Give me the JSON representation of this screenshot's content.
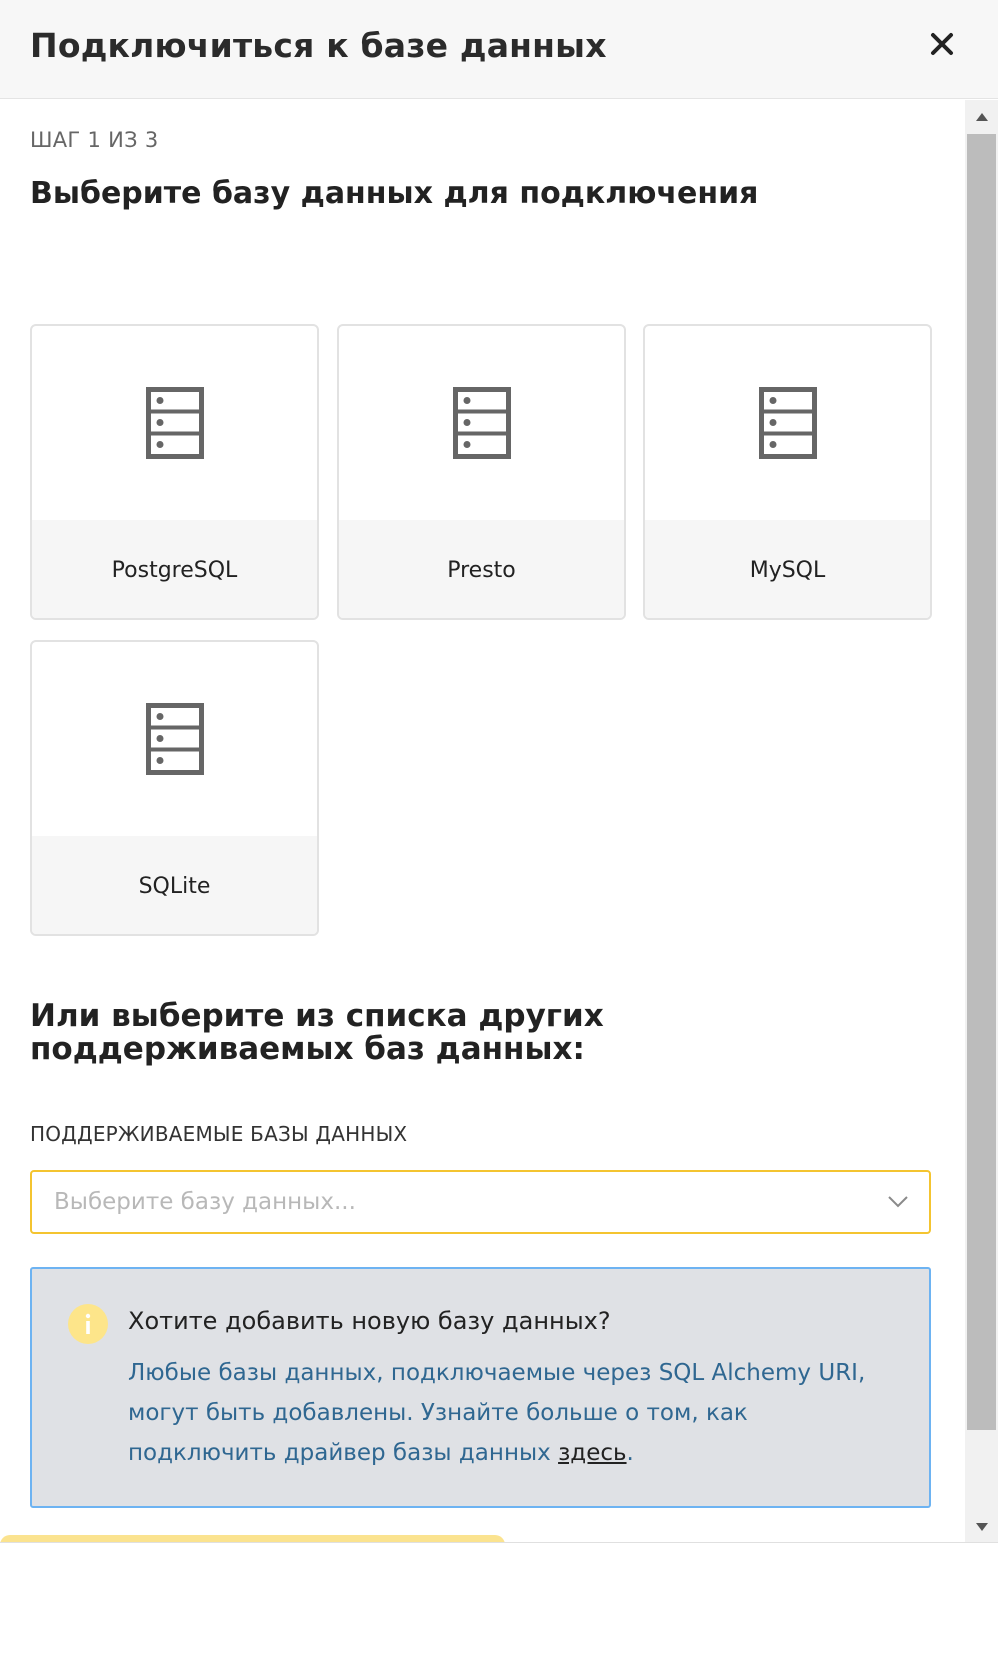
{
  "modal": {
    "title": "Подключиться к базе данных",
    "close_icon": "close-icon"
  },
  "step": {
    "label": "ШАГ 1 ИЗ 3",
    "heading": "Выберите базу данных для подключения"
  },
  "databases": [
    {
      "name": "PostgreSQL",
      "icon": "database-icon"
    },
    {
      "name": "Presto",
      "icon": "database-icon"
    },
    {
      "name": "MySQL",
      "icon": "database-icon"
    },
    {
      "name": "SQLite",
      "icon": "database-icon"
    }
  ],
  "other": {
    "heading": "Или выберите из списка других поддерживаемых баз данных:",
    "select_label": "ПОДДЕРЖИВАЕМЫЕ БАЗЫ ДАННЫХ",
    "select_placeholder": "Выберите базу данных..."
  },
  "info": {
    "title": "Хотите добавить новую базу данных?",
    "text": "Любые базы данных, подключаемые через SQL Alchemy URI, могут быть добавлены. Узнайте больше о том, как подключить драйвер базы данных ",
    "link": "здесь",
    "suffix": "."
  },
  "colors": {
    "accent": "#f4c430",
    "info_border": "#6db3f2",
    "info_text": "#2f6791",
    "info_bg": "#dfe1e5"
  }
}
